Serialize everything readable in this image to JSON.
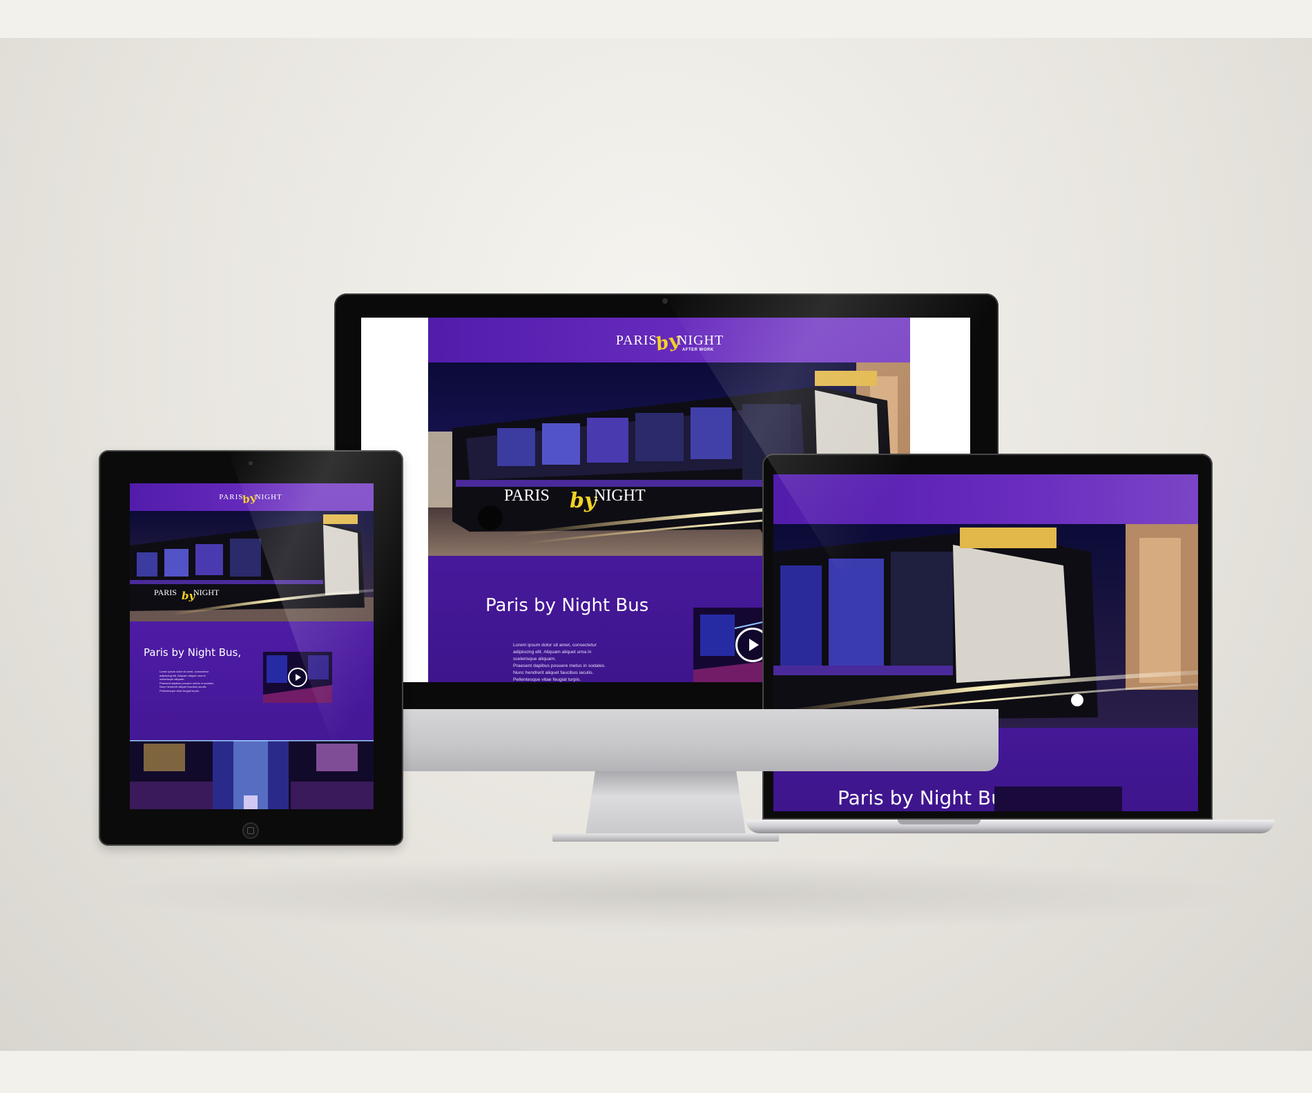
{
  "site": {
    "logo": {
      "paris": "PARIS",
      "by": "by",
      "night": "NIGHT",
      "after_work": "AFTER WORK"
    },
    "desktop": {
      "heading": "Paris by Night Bus",
      "paragraph_lines": [
        "Lorem ipsum dolor sit amet, consectetur",
        "adipiscing elit. Aliquam aliquet urna in",
        "scelerisque aliquam.",
        "Praesent dapibus posuere metus in sodales.",
        "Nunc hendrerit aliquet faucibus iaculis.",
        "Pellentesque vitae feugiat turpis."
      ]
    },
    "tablet": {
      "heading": "Paris by Night Bus,"
    },
    "laptop": {
      "heading": "Paris by Night Bus"
    }
  },
  "colors": {
    "brand_purple": "#4a1aa0",
    "logo_yellow": "#f3d322",
    "background": "#e9e6e0"
  },
  "icons": [
    "play-icon",
    "home-button-icon",
    "camera-icon"
  ]
}
